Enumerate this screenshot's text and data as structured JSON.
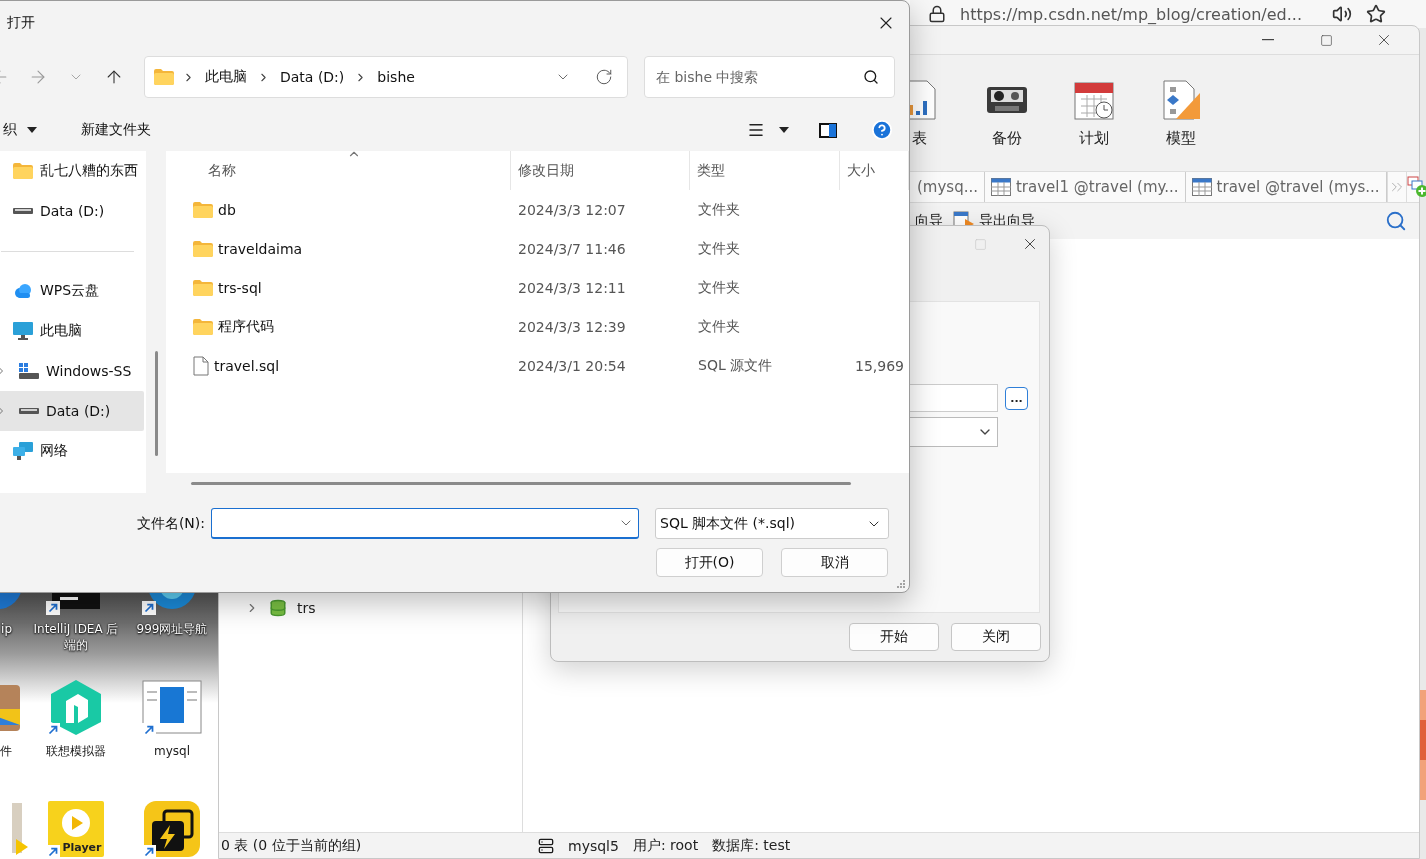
{
  "desktop": {
    "icons": [
      {
        "label": "ip",
        "kind": "app-blue",
        "shortcut": false
      },
      {
        "label": "IntelliJ IDEA 后端的",
        "kind": "ide",
        "shortcut": true
      },
      {
        "label": "999网址导航",
        "kind": "browser",
        "shortcut": true
      },
      {
        "label": "件",
        "kind": "package",
        "shortcut": false
      },
      {
        "label": "联想模拟器",
        "kind": "emulator",
        "shortcut": true
      },
      {
        "label": "mysql",
        "kind": "window",
        "shortcut": true
      },
      {
        "kind": "tool",
        "shortcut": false
      },
      {
        "kind": "player",
        "caption": "Player",
        "shortcut": true
      },
      {
        "kind": "flash",
        "shortcut": true
      }
    ]
  },
  "browser": {
    "url": "https://mp.csdn.net/mp_blog/creation/ed..."
  },
  "navicat": {
    "toolbar": [
      {
        "label": "表",
        "kind": "report"
      },
      {
        "label": "备份",
        "kind": "backup"
      },
      {
        "label": "计划",
        "kind": "schedule"
      },
      {
        "label": "模型",
        "kind": "model"
      }
    ],
    "tabs": [
      {
        "label": "(mysq...",
        "kind": "query"
      },
      {
        "label": "travel1 @travel (my...",
        "kind": "table"
      },
      {
        "label": "travel @travel (mys...",
        "kind": "table"
      }
    ],
    "actions": [
      {
        "label": "向导",
        "kind": "text"
      },
      {
        "label": "导出向导",
        "kind": "export"
      }
    ],
    "tree": [
      {
        "label": "trs",
        "expanded": false
      }
    ],
    "status": {
      "summary": "0 表 (0 位于当前的组)",
      "connection": "mysql5",
      "user": "用户: root",
      "database": "数据库: test"
    }
  },
  "import_dialog": {
    "browse": "...",
    "buttons": [
      "开始",
      "关闭"
    ]
  },
  "open_dialog": {
    "title": "打开",
    "breadcrumb": [
      "此电脑",
      "Data (D:)",
      "bishe"
    ],
    "search_placeholder": "在 bishe 中搜索",
    "organize": "织",
    "new_folder": "新建文件夹",
    "quick_access": [
      {
        "label": "乱七八糟的东西",
        "kind": "folder",
        "selected": false
      },
      {
        "label": "Data (D:)",
        "kind": "drive",
        "selected": false
      }
    ],
    "places": [
      {
        "label": "WPS云盘",
        "kind": "cloud",
        "selected": false
      },
      {
        "label": "此电脑",
        "kind": "pc",
        "selected": false,
        "children": [
          {
            "label": "Windows-SS",
            "kind": "ssd",
            "selected": false,
            "expanded": false
          },
          {
            "label": "Data (D:)",
            "kind": "drive",
            "selected": true,
            "expanded": false
          }
        ]
      },
      {
        "label": "网络",
        "kind": "network",
        "selected": false
      }
    ],
    "columns": [
      "名称",
      "修改日期",
      "类型",
      "大小"
    ],
    "files": [
      {
        "name": "db",
        "date": "2024/3/3 12:07",
        "type": "文件夹",
        "kind": "folder"
      },
      {
        "name": "traveldaima",
        "date": "2024/3/7 11:46",
        "type": "文件夹",
        "kind": "folder"
      },
      {
        "name": "trs-sql",
        "date": "2024/3/3 12:11",
        "type": "文件夹",
        "kind": "folder"
      },
      {
        "name": "程序代码",
        "date": "2024/3/3 12:39",
        "type": "文件夹",
        "kind": "folder"
      },
      {
        "name": "travel.sql",
        "date": "2024/3/1 20:54",
        "type": "SQL 源文件",
        "size": "15,969",
        "kind": "file"
      }
    ],
    "filename_label": "文件名(N):",
    "file_type": "SQL 脚本文件 (*.sql)",
    "buttons": [
      "打开(O)",
      "取消"
    ]
  }
}
